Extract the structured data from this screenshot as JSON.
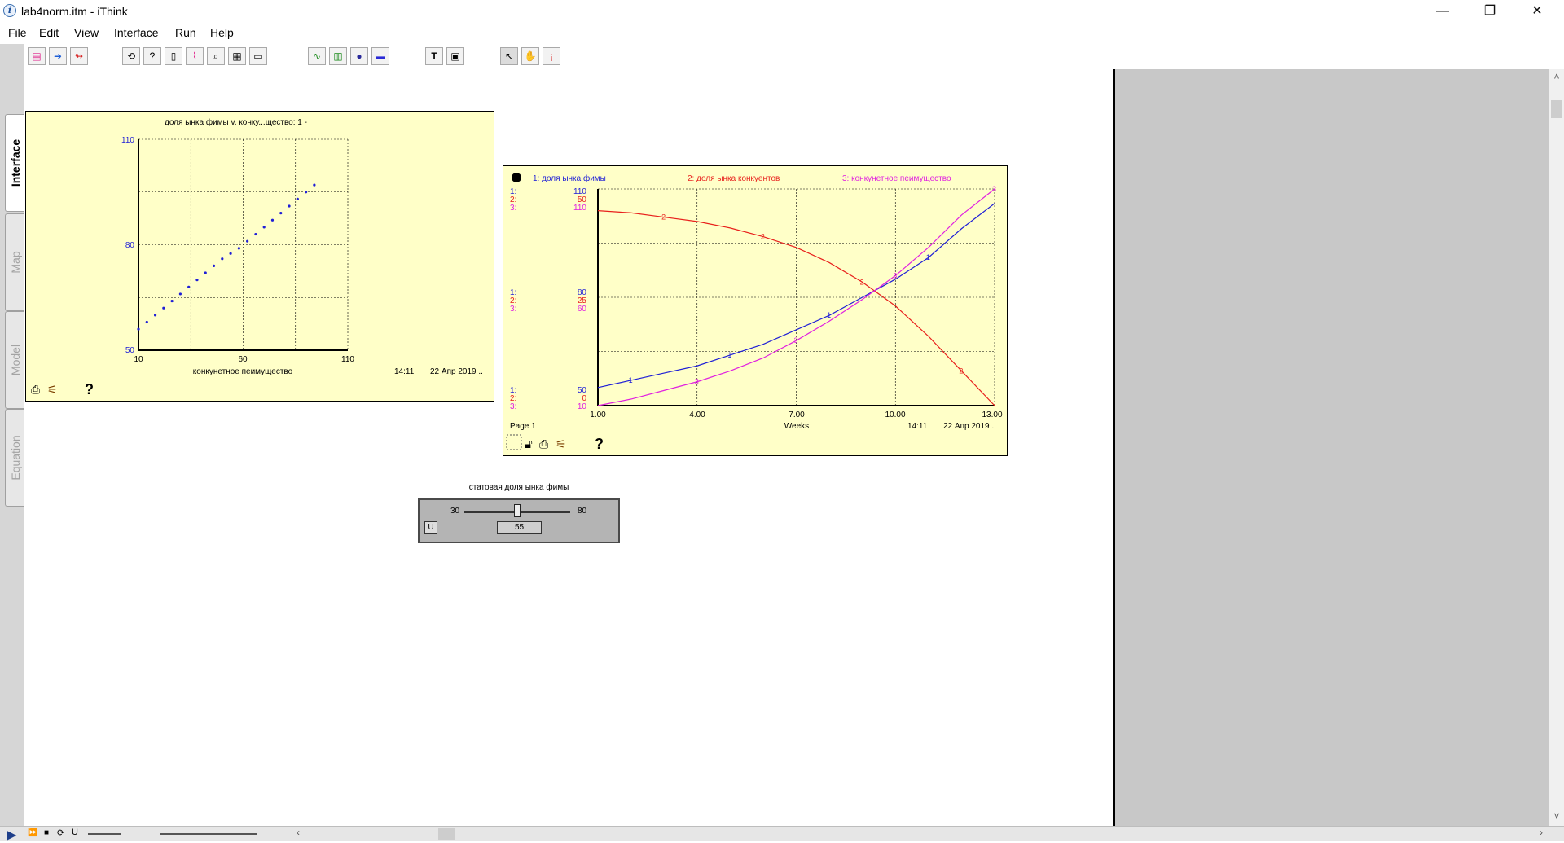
{
  "window": {
    "title": "lab4norm.itm - iThink",
    "controls": {
      "minimize": "—",
      "restore": "❐",
      "close": "✕"
    }
  },
  "menu": [
    "File",
    "Edit",
    "View",
    "Interface",
    "Run",
    "Help"
  ],
  "toolbar_icons": [
    "page-icon",
    "arrow-right-icon",
    "arrow-red-icon",
    "loop-icon",
    "help-icon",
    "doc-icon",
    "chart-icon",
    "find-icon",
    "table-icon",
    "io-icon",
    "graph-icon",
    "grid-icon",
    "dot-icon",
    "numeric-icon",
    "text-icon",
    "picture-icon",
    "pointer-icon",
    "hand-icon",
    "dynamite-icon"
  ],
  "side_tabs": [
    "Interface",
    "Map",
    "Model",
    "Equation"
  ],
  "scatter": {
    "title": "доля ынка фимы v. конку...щество: 1 -",
    "xlabel": "конкунетное пеимущество",
    "time": "14:11",
    "date": "22 Апр 2019 ..",
    "y_ticks": [
      "110",
      "80",
      "50"
    ],
    "x_ticks": [
      "10",
      "60",
      "110"
    ],
    "help": "?"
  },
  "timegraph": {
    "legend": [
      "1: доля ынка фимы",
      "2: доля ынка конкуентов",
      "3: конкунетное пеимущество"
    ],
    "page_label": "Page 1",
    "xlabel": "Weeks",
    "time": "14:11",
    "date": "22 Апр 2019 ..",
    "help": "?",
    "scale_top": [
      "110",
      "50",
      "110"
    ],
    "scale_mid": [
      "80",
      "25",
      "60"
    ],
    "scale_bot": [
      "50",
      "0",
      "10"
    ],
    "series_ids": [
      "1:",
      "2:",
      "3:"
    ],
    "x_ticks": [
      "1.00",
      "4.00",
      "7.00",
      "10.00",
      "13.00"
    ]
  },
  "slider": {
    "title": "статовая доля ынка фимы",
    "min": "30",
    "max": "80",
    "value": "55",
    "reset_label": "U"
  },
  "colors": {
    "series1": "#1f1fd6",
    "series2": "#e8201c",
    "series3": "#e020e0",
    "panel": "#ffffc8"
  },
  "chart_data": [
    {
      "type": "scatter",
      "title": "доля ынка фимы v. конку...щество: 1 -",
      "xlabel": "конкунетное пеимущество",
      "ylabel": "",
      "xlim": [
        10,
        110
      ],
      "ylim": [
        50,
        110
      ],
      "x": [
        10,
        14,
        18,
        22,
        26,
        30,
        34,
        38,
        42,
        46,
        50,
        54,
        58,
        62,
        66,
        70,
        74,
        78,
        82,
        86,
        90,
        94
      ],
      "y": [
        56,
        58,
        60,
        62,
        64,
        66,
        68,
        70,
        72,
        74,
        76,
        77.5,
        79,
        81,
        83,
        85,
        87,
        89,
        91,
        93,
        95,
        97
      ],
      "grid": true
    },
    {
      "type": "line",
      "xlabel": "Weeks",
      "xlim": [
        1,
        13
      ],
      "x": [
        1,
        2,
        3,
        4,
        5,
        6,
        7,
        8,
        9,
        10,
        11,
        12,
        13
      ],
      "series": [
        {
          "name": "1: доля ынка фимы",
          "ylim": [
            50,
            110
          ],
          "values": [
            55,
            57,
            59,
            61,
            64,
            67,
            71,
            75,
            80,
            85,
            91,
            99,
            106
          ]
        },
        {
          "name": "2: доля ынка конкуентов",
          "ylim": [
            0,
            50
          ],
          "values": [
            45,
            44.5,
            43.5,
            42.5,
            41,
            39,
            36.5,
            33,
            28.5,
            23,
            16,
            8,
            0
          ]
        },
        {
          "name": "3: конкунетное пеимущество",
          "ylim": [
            10,
            110
          ],
          "values": [
            10,
            13,
            17,
            21,
            26,
            32,
            40,
            49,
            59,
            70,
            83,
            98,
            110
          ]
        }
      ],
      "grid": true
    }
  ]
}
